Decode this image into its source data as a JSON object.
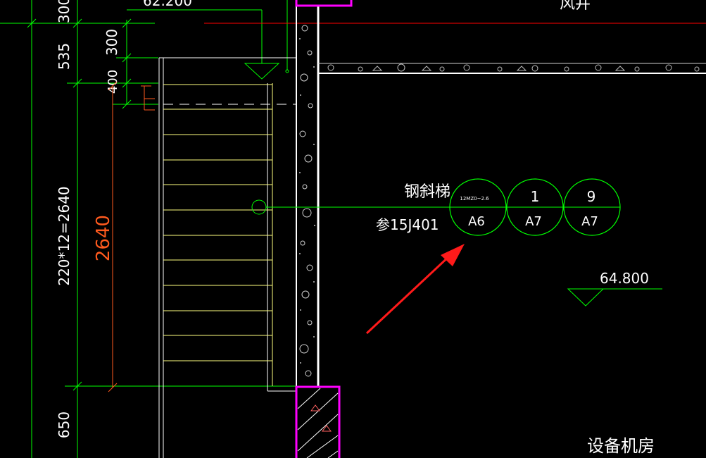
{
  "drawing": {
    "colors": {
      "background": "#000000",
      "dimension_green": "#00ff00",
      "text_white": "#ffffff",
      "stair_yellow": "#ffff80",
      "wall_white": "#ffffff",
      "magenta_column": "#ff00ff",
      "red_line": "#ff0000",
      "red_dim": "#ff5a1e",
      "arrow_red": "#ff1a1a"
    },
    "top_elevation_text": "62.200",
    "shaft_label": "风井",
    "dimensions_left": {
      "d300_top": "300",
      "d535": "535",
      "d300": "300",
      "d400": "400",
      "d_riser_formula": "220*12=2640",
      "d650": "650",
      "d2640": "2640"
    },
    "stair_note": {
      "label": "钢斜梯",
      "reference": "参15J401",
      "bubbles": [
        {
          "top": "12MZ0~2.6",
          "bottom": "A6"
        },
        {
          "top": "1",
          "bottom": "A7"
        },
        {
          "top": "9",
          "bottom": "A7"
        }
      ]
    },
    "level_mark": "64.800",
    "room_label": "设备机房"
  }
}
